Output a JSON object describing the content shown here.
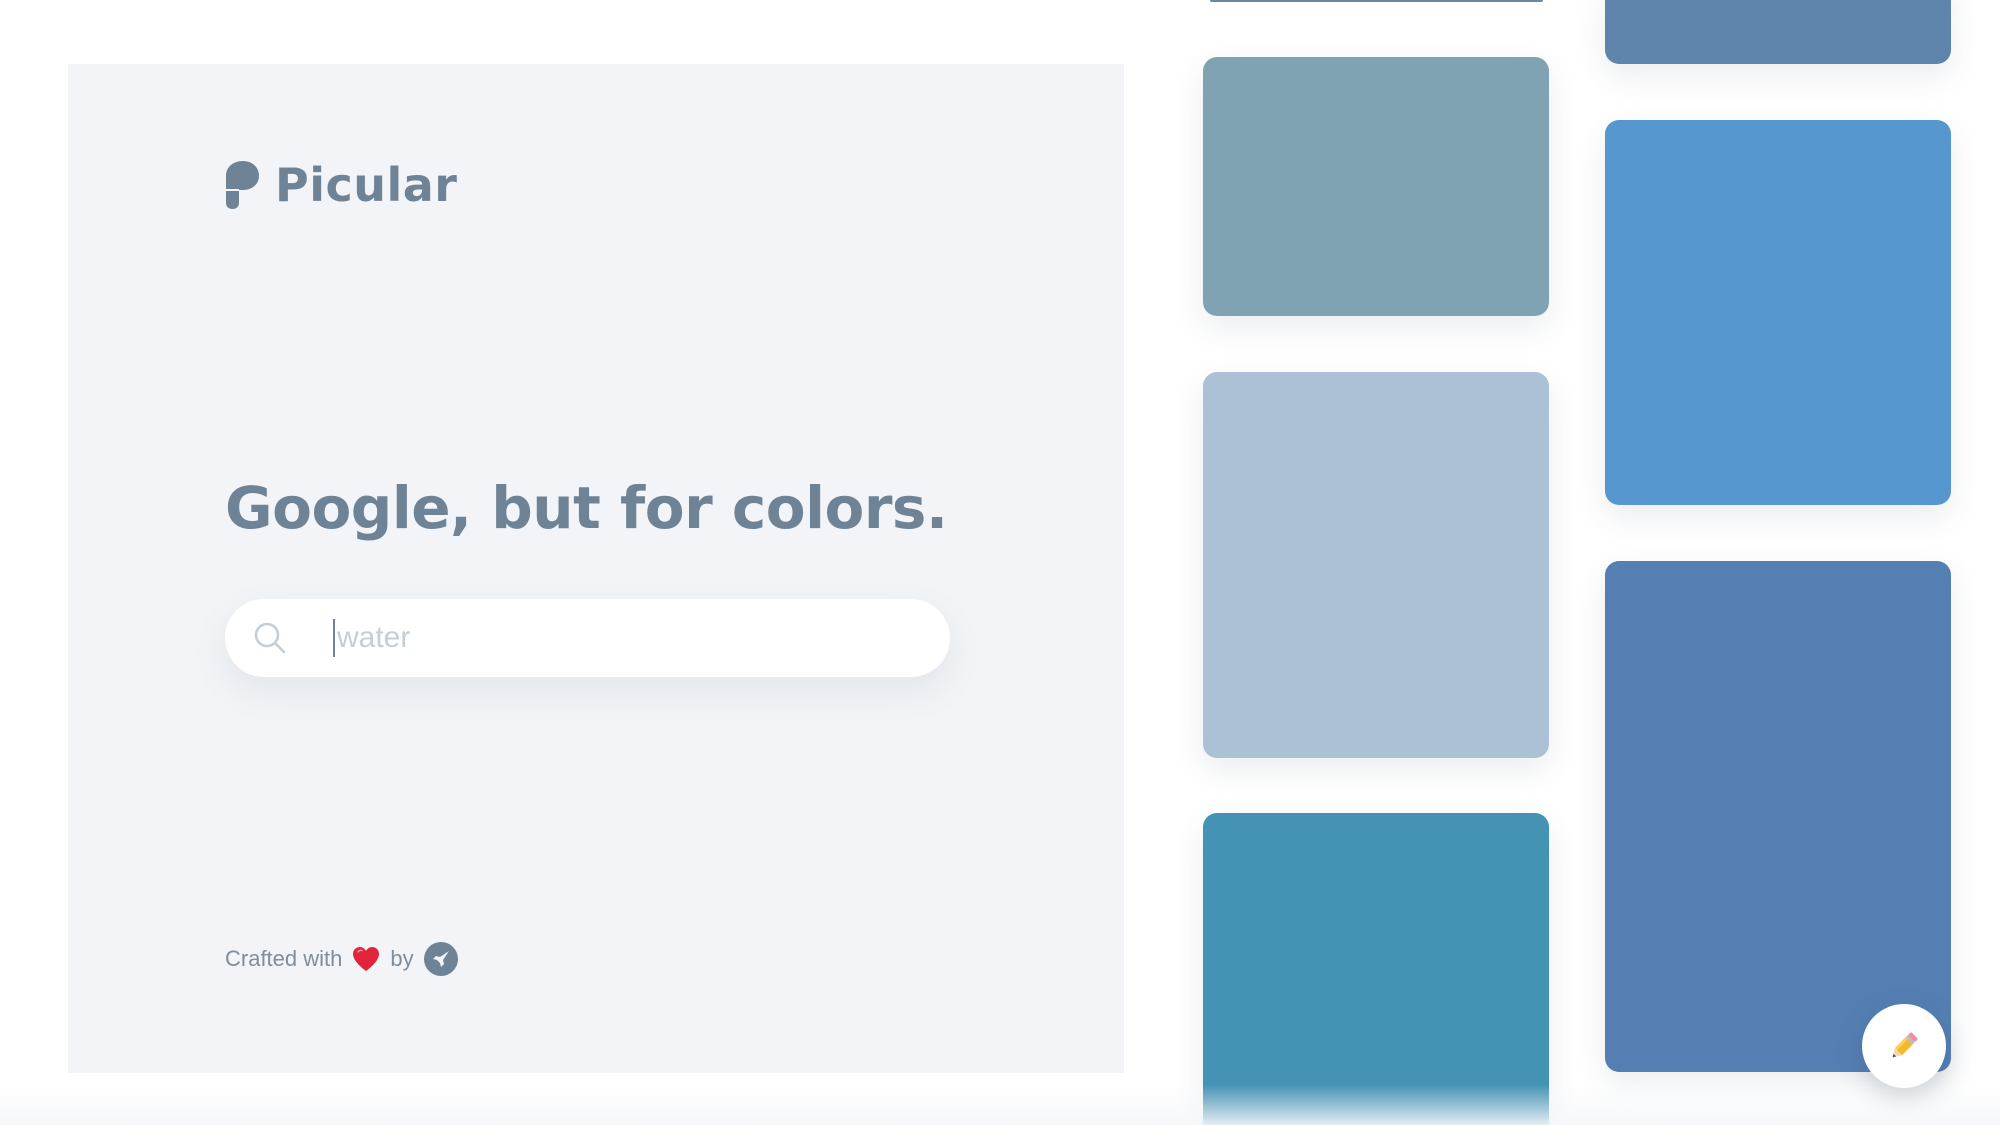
{
  "brand": {
    "name": "Picular",
    "logo_icon": "picular-logo-icon"
  },
  "hero": {
    "headline": "Google, but for colors."
  },
  "search": {
    "placeholder": "water",
    "value": "",
    "icon": "search-icon"
  },
  "footer": {
    "crafted_text": "Crafted with",
    "by_text": "by",
    "heart_icon": "heart-icon",
    "maker_icon": "rocket-icon"
  },
  "tiles": [
    {
      "name": "color-tile-1",
      "color": "#6085ac"
    },
    {
      "name": "color-tile-2",
      "color": "#7fa3b2"
    },
    {
      "name": "color-tile-3",
      "color": "#5797d0"
    },
    {
      "name": "color-tile-4",
      "color": "#acc1d5"
    },
    {
      "name": "color-tile-5",
      "color": "#557fb3"
    },
    {
      "name": "color-tile-6",
      "color": "#4593b4"
    }
  ],
  "fab": {
    "icon": "pencil-icon"
  },
  "colors": {
    "text": "#6f8396",
    "panel": "#f2f4f7",
    "placeholder": "#c5ced8"
  }
}
